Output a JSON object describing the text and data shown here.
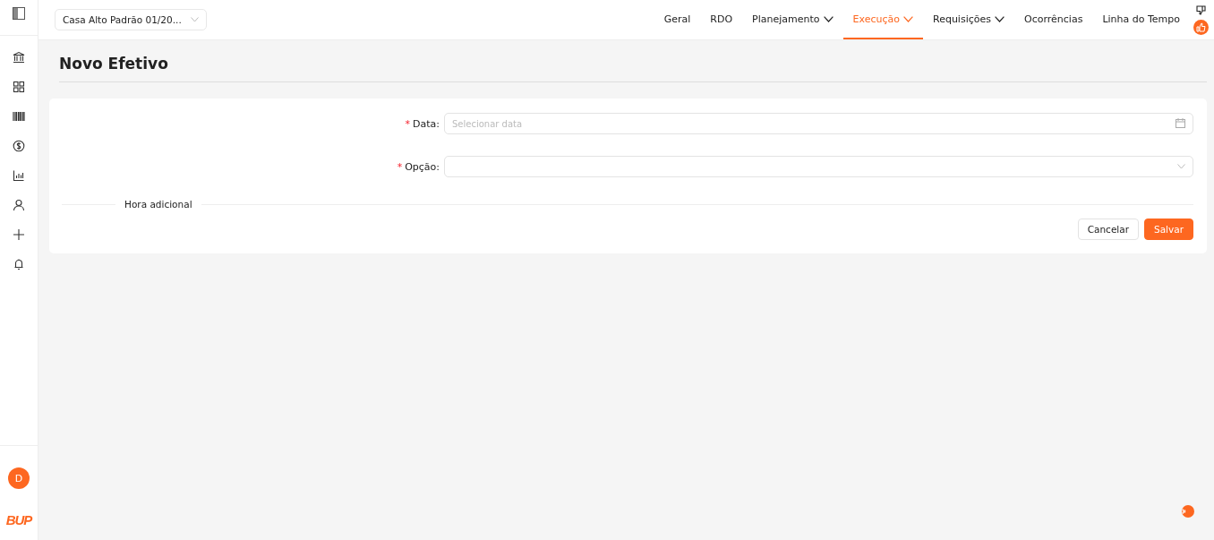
{
  "project_selector": {
    "value": "Casa Alto Padrão 01/20..."
  },
  "nav": [
    {
      "label": "Geral",
      "selected": false,
      "has_menu": false
    },
    {
      "label": "RDO",
      "selected": false,
      "has_menu": false
    },
    {
      "label": "Planejamento",
      "selected": false,
      "has_menu": true
    },
    {
      "label": "Execução",
      "selected": true,
      "has_menu": true
    },
    {
      "label": "Requisições",
      "selected": false,
      "has_menu": true
    },
    {
      "label": "Ocorrências",
      "selected": false,
      "has_menu": false
    },
    {
      "label": "Linha do Tempo",
      "selected": false,
      "has_menu": false
    }
  ],
  "sidebar": {
    "items": [
      {
        "kind": "bank"
      },
      {
        "kind": "grid"
      },
      {
        "kind": "barcode"
      },
      {
        "kind": "money"
      },
      {
        "kind": "chart"
      },
      {
        "kind": "user"
      },
      {
        "kind": "plus"
      },
      {
        "kind": "bell"
      }
    ],
    "avatar": "D",
    "logo": "BUP"
  },
  "page_title": "Novo Efetivo",
  "form": {
    "fields": [
      {
        "label": "Data:",
        "required_mark": "*",
        "kind": "date",
        "placeholder": "Selecionar data"
      },
      {
        "label": "Opção:",
        "required_mark": "*",
        "kind": "select"
      }
    ],
    "section": "Hora adicional",
    "buttons": [
      {
        "label": "Cancelar",
        "primary": false
      },
      {
        "label": "Salvar",
        "primary": true
      }
    ]
  }
}
